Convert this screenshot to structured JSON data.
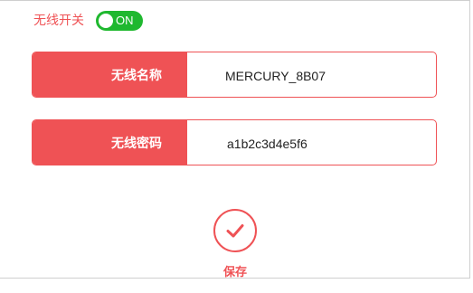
{
  "wireless_switch": {
    "label": "无线开关",
    "state_text": "ON",
    "on": true
  },
  "ssid_field": {
    "label": "无线名称",
    "value": "MERCURY_8B07"
  },
  "password_field": {
    "label": "无线密码",
    "value": "a1b2c3d4e5f6"
  },
  "save": {
    "label": "保存",
    "icon": "check-icon"
  },
  "colors": {
    "accent": "#ef5255",
    "toggle_on": "#1fb82f"
  }
}
